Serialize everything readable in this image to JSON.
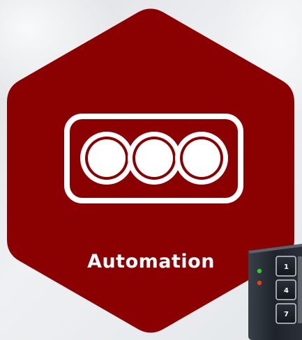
{
  "tile": {
    "label": "Automation",
    "icon": "traffic-light-icon",
    "background_color": "#8b0000",
    "icon_color": "#ffffff"
  },
  "device": {
    "icon": "keypad-icon",
    "keys": [
      "1",
      "4",
      "7"
    ],
    "indicator_colors": [
      "#39c739",
      "#e8420e"
    ]
  }
}
